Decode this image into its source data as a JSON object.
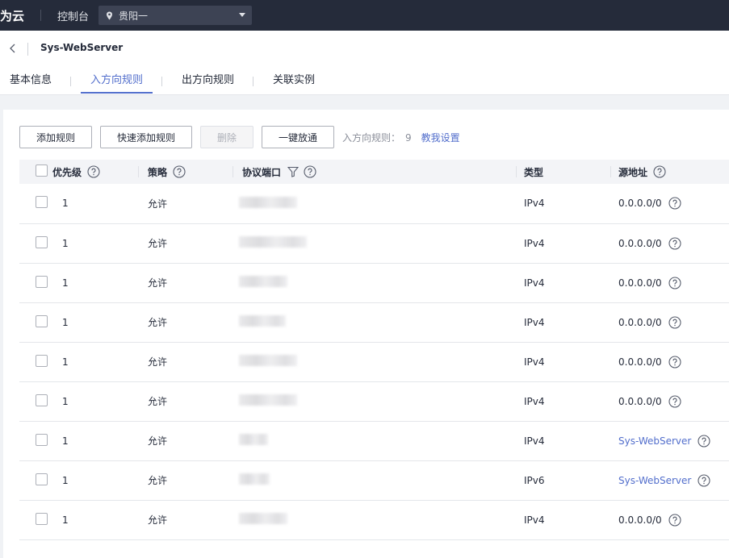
{
  "topbar": {
    "brand": "为云",
    "console": "控制台",
    "region": "贵阳一"
  },
  "header": {
    "title": "Sys-WebServer",
    "tabs": [
      {
        "label": "基本信息",
        "active": false
      },
      {
        "label": "入方向规则",
        "active": true
      },
      {
        "label": "出方向规则",
        "active": false
      },
      {
        "label": "关联实例",
        "active": false
      }
    ]
  },
  "toolbar": {
    "add_rule": "添加规则",
    "quick_add": "快速添加规则",
    "delete": "删除",
    "allow_all": "一键放通",
    "count_label": "入方向规则：",
    "count_value": "9",
    "help_link": "教我设置"
  },
  "table": {
    "headers": {
      "priority": "优先级",
      "policy": "策略",
      "protocol_port": "协议端口",
      "type": "类型",
      "source": "源地址"
    },
    "rows": [
      {
        "priority": "1",
        "policy": "允许",
        "type": "IPv4",
        "source": "0.0.0.0/0",
        "source_link": false
      },
      {
        "priority": "1",
        "policy": "允许",
        "type": "IPv4",
        "source": "0.0.0.0/0",
        "source_link": false
      },
      {
        "priority": "1",
        "policy": "允许",
        "type": "IPv4",
        "source": "0.0.0.0/0",
        "source_link": false
      },
      {
        "priority": "1",
        "policy": "允许",
        "type": "IPv4",
        "source": "0.0.0.0/0",
        "source_link": false
      },
      {
        "priority": "1",
        "policy": "允许",
        "type": "IPv4",
        "source": "0.0.0.0/0",
        "source_link": false
      },
      {
        "priority": "1",
        "policy": "允许",
        "type": "IPv4",
        "source": "0.0.0.0/0",
        "source_link": false
      },
      {
        "priority": "1",
        "policy": "允许",
        "type": "IPv4",
        "source": "Sys-WebServer",
        "source_link": true
      },
      {
        "priority": "1",
        "policy": "允许",
        "type": "IPv6",
        "source": "Sys-WebServer",
        "source_link": true
      },
      {
        "priority": "1",
        "policy": "允许",
        "type": "IPv4",
        "source": "0.0.0.0/0",
        "source_link": false
      }
    ]
  },
  "colors": {
    "topbar": "#252b3a",
    "accent": "#526ecc",
    "header_bg": "#f3f4f7"
  }
}
